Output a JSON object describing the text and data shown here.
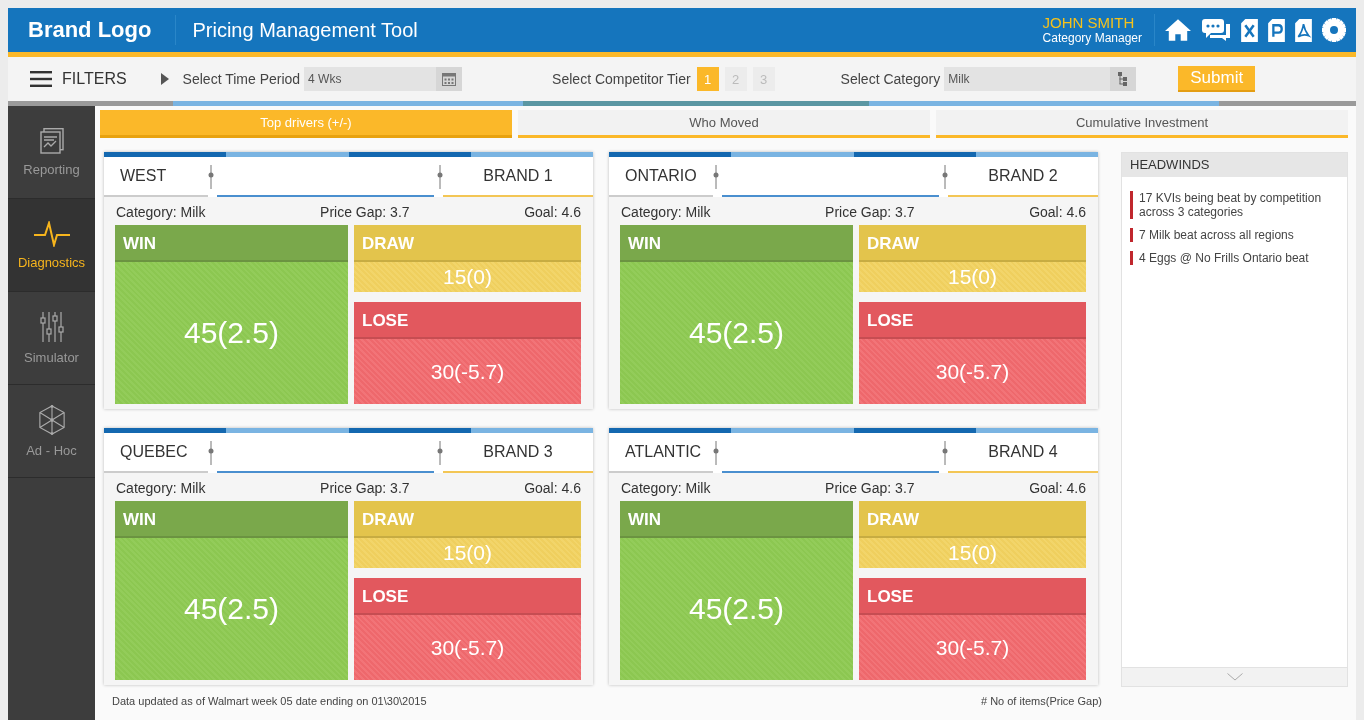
{
  "header": {
    "logo": "Brand Logo",
    "title": "Pricing Management Tool",
    "user": {
      "name": "JOHN SMITH",
      "role": "Category Manager"
    }
  },
  "filters": {
    "label": "FILTERS",
    "time_period": {
      "label": "Select Time Period",
      "value": "4 Wks"
    },
    "competitor_tier": {
      "label": "Select Competitor Tier",
      "options": [
        {
          "label": "1",
          "selected": true
        },
        {
          "label": "2",
          "selected": false
        },
        {
          "label": "3",
          "selected": false
        }
      ]
    },
    "category": {
      "label": "Select Category",
      "value": "Milk"
    },
    "submit": "Submit"
  },
  "sidebar": {
    "items": [
      {
        "label": "Reporting",
        "kind": "report",
        "selected": false
      },
      {
        "label": "Diagnostics",
        "kind": "pulse",
        "selected": true
      },
      {
        "label": "Simulator",
        "kind": "sliders",
        "selected": false
      },
      {
        "label": "Ad - Hoc",
        "kind": "cube",
        "selected": false
      }
    ]
  },
  "tabs": [
    {
      "label": "Top drivers (+/-)",
      "selected": true
    },
    {
      "label": "Who Moved",
      "selected": false
    },
    {
      "label": "Cumulative Investment",
      "selected": false
    }
  ],
  "cards": [
    {
      "region": "WEST",
      "brand": "BRAND 1",
      "category": "Category: Milk",
      "price_gap": "Price Gap: 3.7",
      "goal": "Goal: 4.6",
      "win": {
        "label": "WIN",
        "value": "45(2.5)"
      },
      "draw": {
        "label": "DRAW",
        "value": "15(0)"
      },
      "lose": {
        "label": "LOSE",
        "value": "30(-5.7)"
      }
    },
    {
      "region": "ONTARIO",
      "brand": "BRAND 2",
      "category": "Category: Milk",
      "price_gap": "Price Gap: 3.7",
      "goal": "Goal: 4.6",
      "win": {
        "label": "WIN",
        "value": "45(2.5)"
      },
      "draw": {
        "label": "DRAW",
        "value": "15(0)"
      },
      "lose": {
        "label": "LOSE",
        "value": "30(-5.7)"
      }
    },
    {
      "region": "QUEBEC",
      "brand": "BRAND 3",
      "category": "Category: Milk",
      "price_gap": "Price Gap: 3.7",
      "goal": "Goal: 4.6",
      "win": {
        "label": "WIN",
        "value": "45(2.5)"
      },
      "draw": {
        "label": "DRAW",
        "value": "15(0)"
      },
      "lose": {
        "label": "LOSE",
        "value": "30(-5.7)"
      }
    },
    {
      "region": "ATLANTIC",
      "brand": "BRAND 4",
      "category": "Category: Milk",
      "price_gap": "Price Gap: 3.7",
      "goal": "Goal: 4.6",
      "win": {
        "label": "WIN",
        "value": "45(2.5)"
      },
      "draw": {
        "label": "DRAW",
        "value": "15(0)"
      },
      "lose": {
        "label": "LOSE",
        "value": "30(-5.7)"
      }
    }
  ],
  "headwinds": {
    "title": "HEADWINDS",
    "items": [
      "17 KVIs being beat by competition across 3 categories",
      "7 Milk beat across all regions",
      "4 Eggs @ No Frills Ontario beat"
    ]
  },
  "footer": {
    "note": "Data updated as of Walmart week 05 date ending on 01\\30\\2015",
    "legend": "# No of items(Price Gap)"
  }
}
